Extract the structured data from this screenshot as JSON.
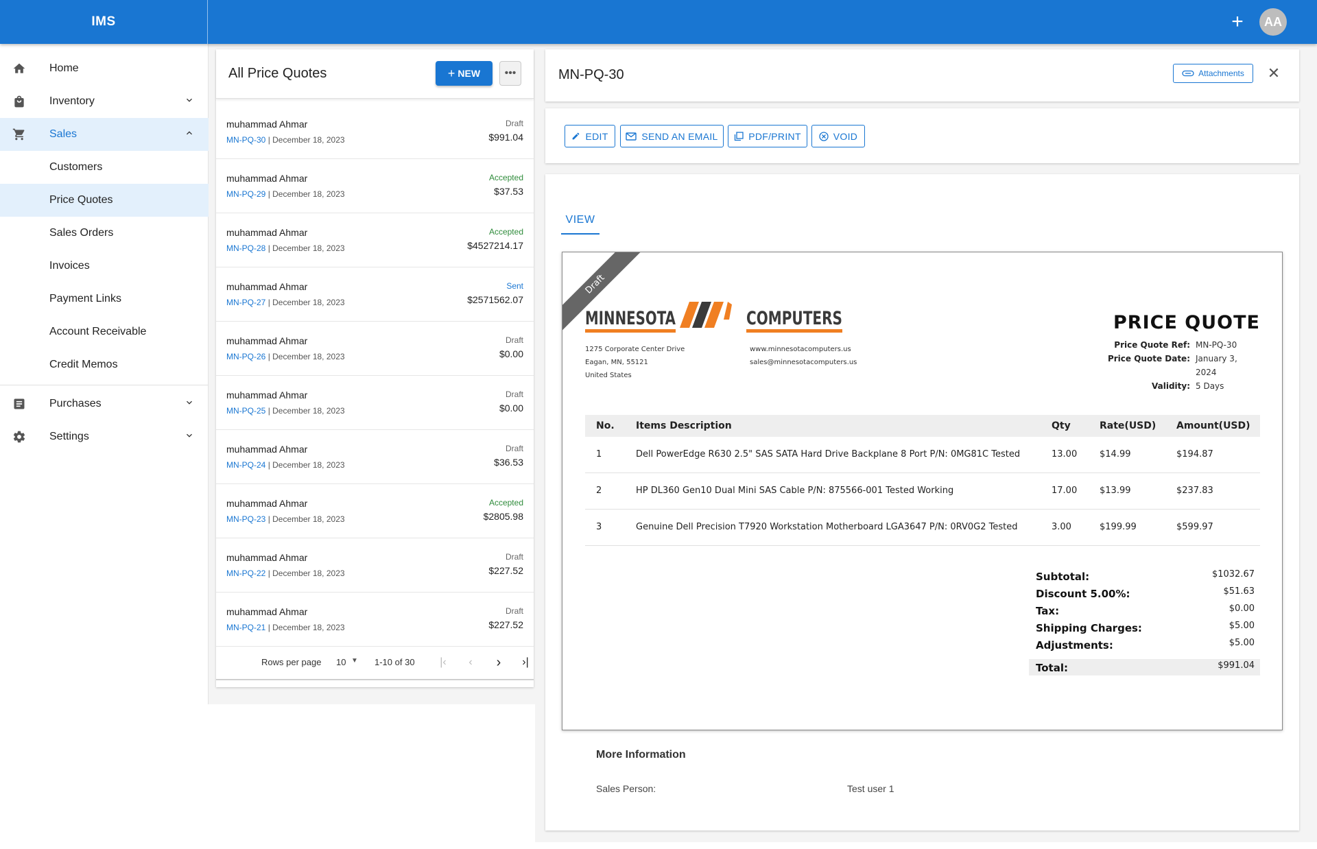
{
  "app": {
    "title": "IMS",
    "avatar_initials": "AA",
    "accent": "#1976d2"
  },
  "sidebar": {
    "items": [
      {
        "label": "Home",
        "icon": "home-icon"
      },
      {
        "label": "Inventory",
        "icon": "bag-icon"
      },
      {
        "label": "Sales",
        "icon": "cart-icon"
      },
      {
        "label": "Customers"
      },
      {
        "label": "Price Quotes"
      },
      {
        "label": "Sales Orders"
      },
      {
        "label": "Invoices"
      },
      {
        "label": "Payment Links"
      },
      {
        "label": "Account Receivable"
      },
      {
        "label": "Credit Memos"
      },
      {
        "label": "Purchases",
        "icon": "list-icon"
      },
      {
        "label": "Settings",
        "icon": "gear-icon"
      }
    ]
  },
  "list": {
    "title": "All Price Quotes",
    "new_label": "NEW",
    "rows": [
      {
        "customer": "muhammad Ahmar",
        "code": "MN-PQ-30",
        "date": "| December 18, 2023",
        "status": "Draft",
        "amount": "$991.04"
      },
      {
        "customer": "muhammad Ahmar",
        "code": "MN-PQ-29",
        "date": "| December 18, 2023",
        "status": "Accepted",
        "amount": "$37.53"
      },
      {
        "customer": "muhammad Ahmar",
        "code": "MN-PQ-28",
        "date": "| December 18, 2023",
        "status": "Accepted",
        "amount": "$4527214.17"
      },
      {
        "customer": "muhammad Ahmar",
        "code": "MN-PQ-27",
        "date": "| December 18, 2023",
        "status": "Sent",
        "amount": "$2571562.07"
      },
      {
        "customer": "muhammad Ahmar",
        "code": "MN-PQ-26",
        "date": "| December 18, 2023",
        "status": "Draft",
        "amount": "$0.00"
      },
      {
        "customer": "muhammad Ahmar",
        "code": "MN-PQ-25",
        "date": "| December 18, 2023",
        "status": "Draft",
        "amount": "$0.00"
      },
      {
        "customer": "muhammad Ahmar",
        "code": "MN-PQ-24",
        "date": "| December 18, 2023",
        "status": "Draft",
        "amount": "$36.53"
      },
      {
        "customer": "muhammad Ahmar",
        "code": "MN-PQ-23",
        "date": "| December 18, 2023",
        "status": "Accepted",
        "amount": "$2805.98"
      },
      {
        "customer": "muhammad Ahmar",
        "code": "MN-PQ-22",
        "date": "| December 18, 2023",
        "status": "Draft",
        "amount": "$227.52"
      },
      {
        "customer": "muhammad Ahmar",
        "code": "MN-PQ-21",
        "date": "| December 18, 2023",
        "status": "Draft",
        "amount": "$227.52"
      }
    ],
    "pager": {
      "rows_per_page_label": "Rows per page",
      "rows_per_page": "10",
      "range": "1-10 of 30"
    }
  },
  "detail": {
    "title": "MN-PQ-30",
    "attachments_label": "Attachments",
    "actions": {
      "edit": "EDIT",
      "email": "SEND AN EMAIL",
      "pdf": "PDF/PRINT",
      "void": "VOID"
    },
    "tab": "VIEW",
    "quote": {
      "ribbon": "Draft",
      "logo_left": "MINNESOTA",
      "logo_right": "COMPUTERS",
      "address": [
        "1275 Corporate Center Drive",
        "Eagan, MN, 55121",
        "United States"
      ],
      "contact": [
        "www.minnesotacomputers.us",
        "sales@minnesotacomputers.us"
      ],
      "heading": "PRICE QUOTE",
      "meta": [
        {
          "k": "Price Quote Ref:",
          "v": "MN-PQ-30"
        },
        {
          "k": "Price Quote Date:",
          "v": "January 3, 2024"
        },
        {
          "k": "Validity:",
          "v": "5 Days"
        }
      ],
      "columns": [
        "No.",
        "Items Description",
        "Qty",
        "Rate(USD)",
        "Amount(USD)"
      ],
      "items": [
        {
          "no": "1",
          "desc": "Dell PowerEdge R630 2.5\" SAS SATA Hard Drive Backplane 8 Port P/N: 0MG81C Tested",
          "qty": "13.00",
          "rate": "$14.99",
          "amount": "$194.87"
        },
        {
          "no": "2",
          "desc": "HP DL360 Gen10 Dual Mini SAS Cable P/N: 875566-001 Tested Working",
          "qty": "17.00",
          "rate": "$13.99",
          "amount": "$237.83"
        },
        {
          "no": "3",
          "desc": "Genuine Dell Precision T7920 Workstation Motherboard LGA3647 P/N: 0RV0G2 Tested",
          "qty": "3.00",
          "rate": "$199.99",
          "amount": "$599.97"
        }
      ],
      "totals": [
        {
          "k": "Subtotal:",
          "v": "$1032.67"
        },
        {
          "k": "Discount 5.00%:",
          "v": "$51.63"
        },
        {
          "k": "Tax:",
          "v": "$0.00"
        },
        {
          "k": "Shipping Charges:",
          "v": "$5.00"
        },
        {
          "k": "Adjustments:",
          "v": "$5.00"
        }
      ],
      "grand_total": {
        "k": "Total:",
        "v": "$991.04"
      }
    },
    "more": {
      "title": "More Information",
      "sales_person_label": "Sales Person:",
      "sales_person": "Test user 1"
    }
  }
}
